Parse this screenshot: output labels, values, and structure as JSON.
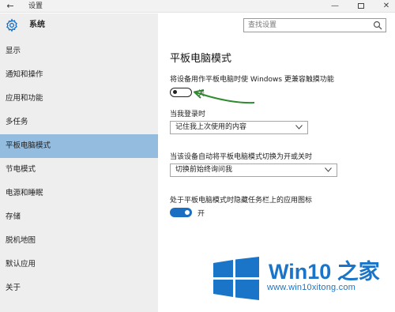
{
  "window": {
    "title": "设置",
    "back_icon": "←",
    "minimize_icon": "—",
    "close_icon": "✕"
  },
  "sidebar": {
    "header": "系统",
    "items": [
      {
        "label": "显示"
      },
      {
        "label": "通知和操作"
      },
      {
        "label": "应用和功能"
      },
      {
        "label": "多任务"
      },
      {
        "label": "平板电脑模式",
        "active": true
      },
      {
        "label": "节电模式"
      },
      {
        "label": "电源和睡眠"
      },
      {
        "label": "存储"
      },
      {
        "label": "脱机地图"
      },
      {
        "label": "默认应用"
      },
      {
        "label": "关于"
      }
    ]
  },
  "search": {
    "placeholder": "查找设置"
  },
  "main": {
    "title": "平板电脑模式",
    "touch_mode": {
      "label": "将设备用作平板电脑时使 Windows 更兼容触摸功能",
      "state": "关",
      "on": false
    },
    "signin": {
      "label": "当我登录时",
      "value": "记住我上次使用的内容"
    },
    "auto_switch": {
      "label": "当该设备自动将平板电脑模式切换为开或关时",
      "value": "切换前始终询问我"
    },
    "hide_icons": {
      "label": "处于平板电脑模式时隐藏任务栏上的应用图标",
      "state": "开",
      "on": true
    }
  },
  "watermark": {
    "brand": "Win10 之家",
    "url": "www.win10xitong.com",
    "accent": "#1a74c8"
  },
  "colors": {
    "sidebar_bg": "#eeeeee",
    "active_item": "#93bcdf",
    "toggle_on": "#1a6fc2",
    "annotation_arrow": "#2e8b2e"
  }
}
